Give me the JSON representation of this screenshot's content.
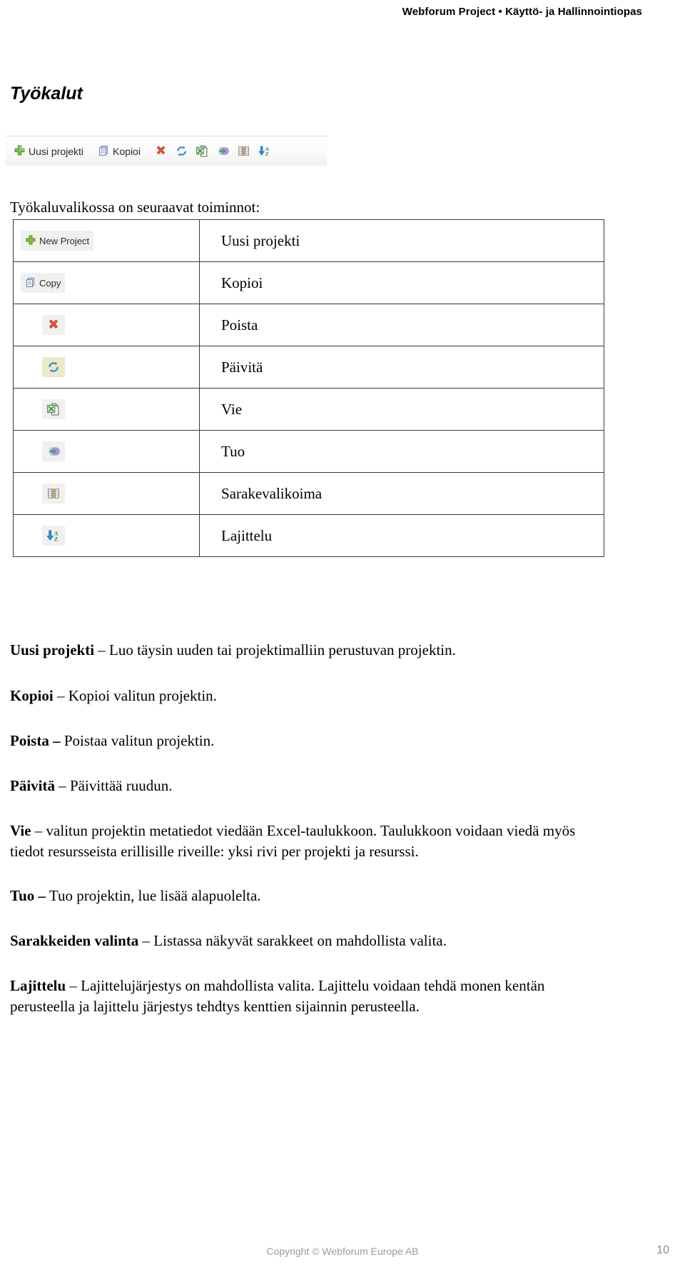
{
  "header": {
    "running_head": "Webforum Project • Käyttö- ja Hallinnointiopas"
  },
  "page_title": "Työkalut",
  "toolbar": {
    "items": [
      {
        "icon": "plus-green-icon",
        "label": "Uusi projekti"
      },
      {
        "icon": "copy-icon",
        "label": "Kopioi"
      },
      {
        "icon": "delete-x-icon",
        "label": ""
      },
      {
        "icon": "refresh-icon",
        "label": ""
      },
      {
        "icon": "export-excel-icon",
        "label": ""
      },
      {
        "icon": "import-icon",
        "label": ""
      },
      {
        "icon": "columns-icon",
        "label": ""
      },
      {
        "icon": "sort-az-icon",
        "label": ""
      }
    ]
  },
  "intro": "Työkaluvalikossa on seuraavat toiminnot:",
  "table": {
    "rows": [
      {
        "icon": "plus-green-icon",
        "chip_text": "New Project",
        "label": "Uusi projekti"
      },
      {
        "icon": "copy-icon",
        "chip_text": "Copy",
        "label": "Kopioi"
      },
      {
        "icon": "delete-x-icon",
        "chip_text": "",
        "label": "Poista"
      },
      {
        "icon": "refresh-icon",
        "chip_text": "",
        "label": "Päivitä"
      },
      {
        "icon": "export-excel-icon",
        "chip_text": "",
        "label": "Vie"
      },
      {
        "icon": "import-icon",
        "chip_text": "",
        "label": "Tuo"
      },
      {
        "icon": "columns-icon",
        "chip_text": "",
        "label": "Sarakevalikoima"
      },
      {
        "icon": "sort-az-icon",
        "chip_text": "",
        "label": "Lajittelu"
      }
    ]
  },
  "paragraphs": {
    "p1_term": "Uusi projekti",
    "p1_text": " – Luo täysin uuden tai projektimalliin perustuvan projektin.",
    "p2_term": "Kopioi",
    "p2_text": " – Kopioi valitun projektin.",
    "p3_term": "Poista –",
    "p3_text": " Poistaa valitun projektin.",
    "p4_term": "Päivitä",
    "p4_text": " – Päivittää ruudun.",
    "p5_term": "Vie",
    "p5_text": " – valitun projektin metatiedot viedään Excel-taulukkoon. Taulukkoon voidaan viedä myös tiedot resursseista erillisille riveille: yksi rivi per projekti ja resurssi.",
    "p6_term": "Tuo –",
    "p6_text": " Tuo projektin, lue lisää alapuolelta.",
    "p7_term": "Sarakkeiden valinta",
    "p7_text": " – Listassa näkyvät sarakkeet on mahdollista valita.",
    "p8_term": "Lajittelu",
    "p8_text": " – Lajittelujärjestys on mahdollista valita. Lajittelu voidaan tehdä monen kentän perusteella ja lajittelu järjestys tehdtys kenttien sijainnin perusteella."
  },
  "footer": {
    "copyright": "Copyright © Webforum Europe AB",
    "page_number": "10"
  },
  "colors": {
    "green": "#6aa84f",
    "red": "#e8553a",
    "blue": "#2e86c8",
    "orange": "#e8a33d",
    "purple": "#8f8fd0",
    "text": "#000000",
    "footer_gray": "#9a9a9a"
  }
}
